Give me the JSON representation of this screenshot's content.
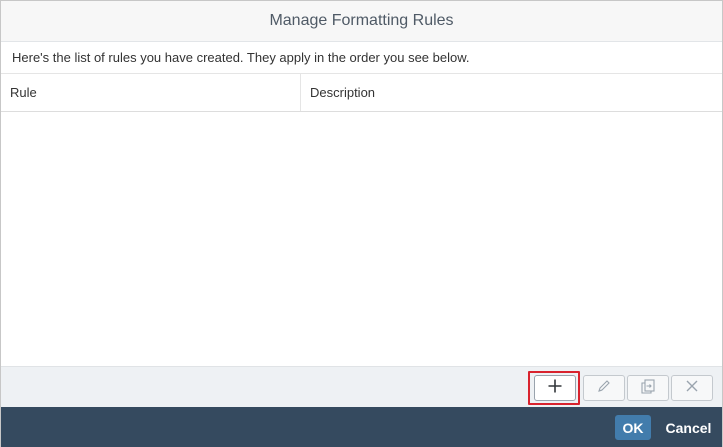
{
  "dialog": {
    "title": "Manage Formatting Rules",
    "intro": "Here's the list of rules you have created. They apply in the order you see below."
  },
  "table": {
    "columns": [
      "Rule",
      "Description"
    ],
    "rows": []
  },
  "toolbar": {
    "buttons": [
      {
        "icon": "add-icon",
        "enabled": true,
        "highlighted": true
      },
      {
        "icon": "edit-icon",
        "enabled": false
      },
      {
        "icon": "duplicate-icon",
        "enabled": false
      },
      {
        "icon": "delete-icon",
        "enabled": false
      }
    ],
    "highlight_color": "#d9232e"
  },
  "footer": {
    "ok_label": "OK",
    "cancel_label": "Cancel",
    "bg_color": "#354a5f",
    "ok_color": "#427cac"
  }
}
